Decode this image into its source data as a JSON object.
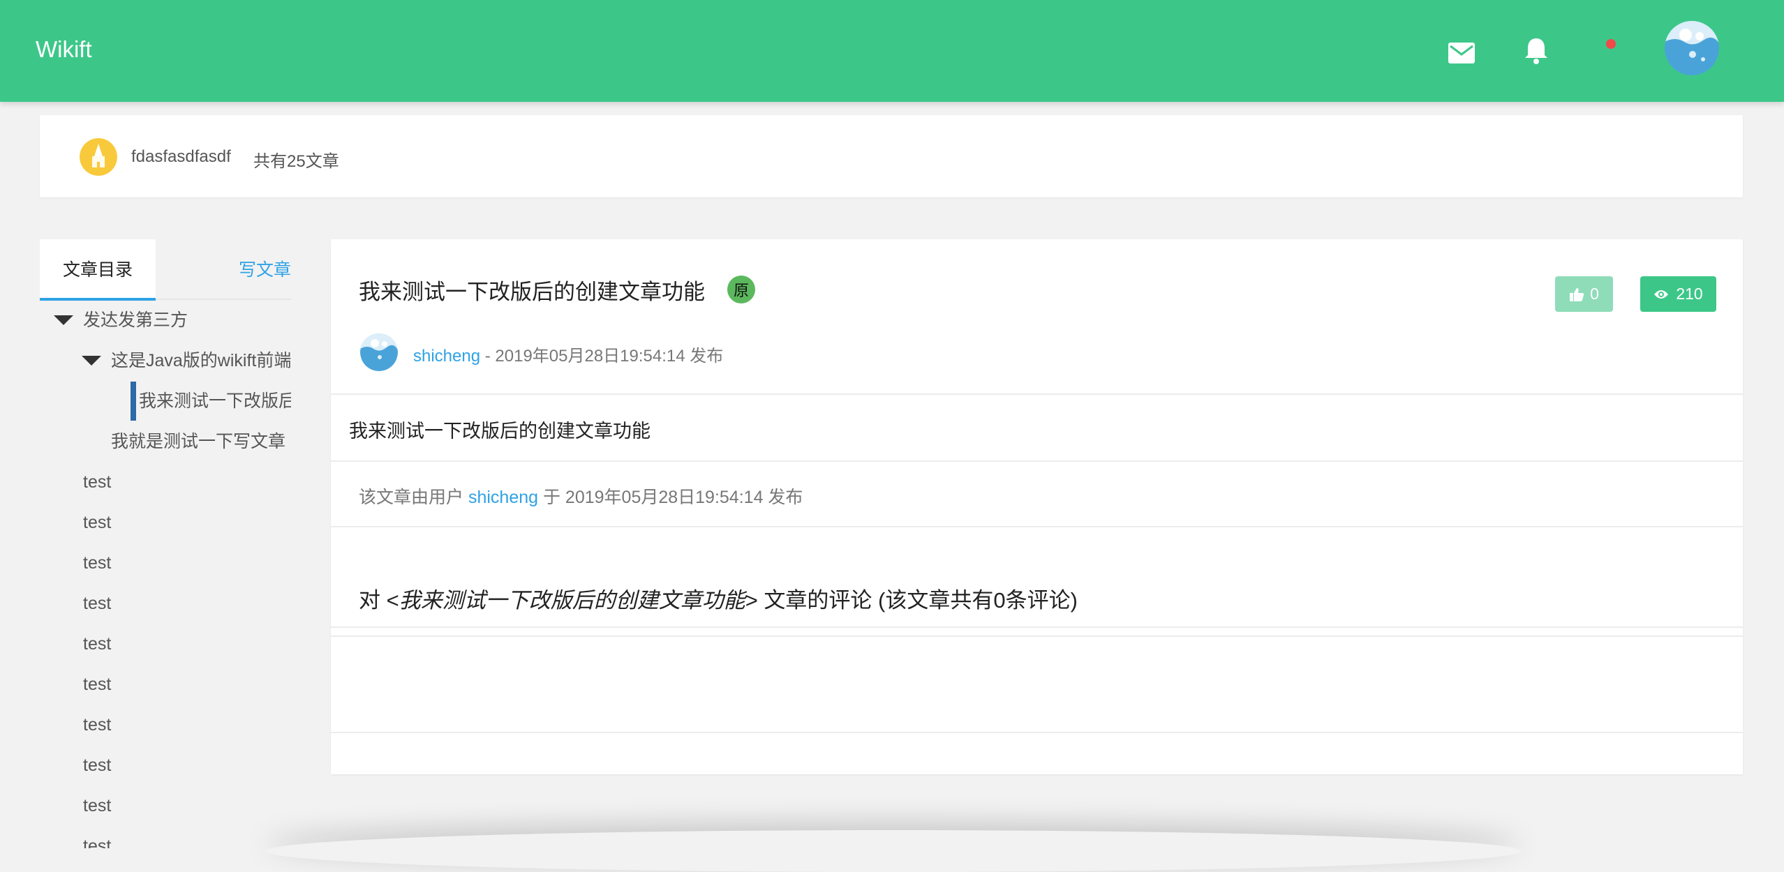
{
  "header": {
    "brand": "Wikift",
    "icons": [
      "mail-icon",
      "bell-icon",
      "notification-dot",
      "avatar"
    ],
    "colors": {
      "bar": "#3cc789",
      "dot": "#f04a4a"
    }
  },
  "author": {
    "name": "fdasfasdfasdf",
    "article_count": "共有25文章"
  },
  "sidebar": {
    "tab_label": "文章目录",
    "write_label": "写文章",
    "tree": [
      {
        "label": "发达发第三方",
        "level": 0,
        "expanded": true
      },
      {
        "label": "这是Java版的wikift前端",
        "level": 1,
        "expanded": true
      },
      {
        "label": "我来测试一下改版后的创建文章功能",
        "level": 2,
        "active": true
      },
      {
        "label": "我就是测试一下写文章",
        "level": 1
      },
      {
        "label": "test",
        "level": 0
      },
      {
        "label": "test",
        "level": 0
      },
      {
        "label": "test",
        "level": 0
      },
      {
        "label": "test",
        "level": 0
      },
      {
        "label": "test",
        "level": 0
      },
      {
        "label": "test",
        "level": 0
      },
      {
        "label": "test",
        "level": 0
      },
      {
        "label": "test",
        "level": 0
      },
      {
        "label": "test",
        "level": 0
      },
      {
        "label": "test",
        "level": 0
      }
    ],
    "accent": "#2ea2e6"
  },
  "article": {
    "title": "我来测试一下改版后的创建文章功能",
    "badge": "原",
    "likes": "0",
    "views": "210",
    "author": "shicheng",
    "meta_suffix": " - 2019年05月28日19:54:14 发布",
    "body": "我来测试一下改版后的创建文章功能",
    "footer_prefix": "该文章由用户 ",
    "footer_author": "shicheng",
    "footer_suffix": " 于 2019年05月28日19:54:14 发布",
    "comments_prefix": "对 <",
    "comments_title": "我来测试一下改版后的创建文章功能",
    "comments_suffix": "> 文章的评论 (该文章共有0条评论)"
  }
}
